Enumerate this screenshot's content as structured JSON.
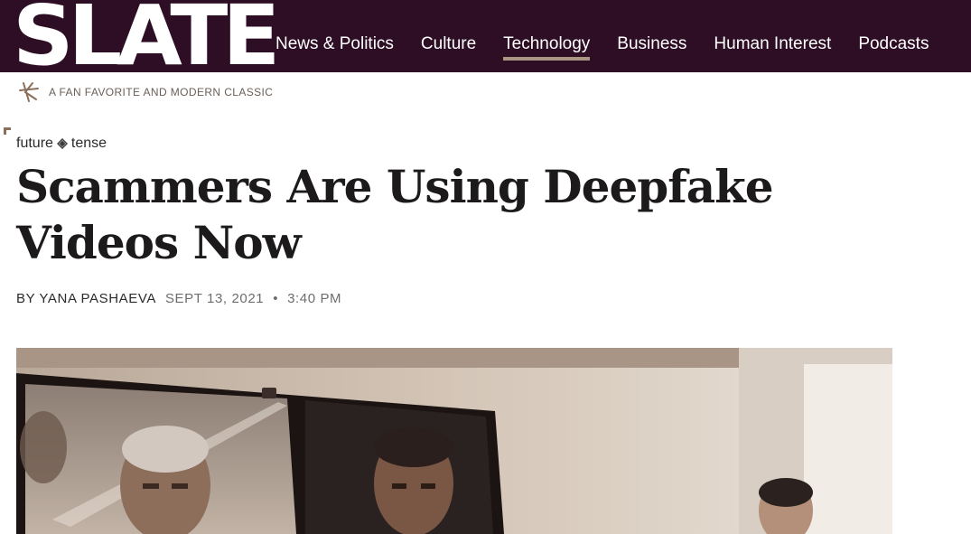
{
  "header": {
    "logo_text": "SLATE",
    "nav": [
      {
        "label": "News & Politics",
        "active": false
      },
      {
        "label": "Culture",
        "active": false
      },
      {
        "label": "Technology",
        "active": true
      },
      {
        "label": "Business",
        "active": false
      },
      {
        "label": "Human Interest",
        "active": false
      },
      {
        "label": "Podcasts",
        "active": false
      }
    ]
  },
  "tagline": {
    "text": "A FAN FAVORITE AND MODERN CLASSIC"
  },
  "kicker": {
    "left": "future",
    "right": "tense",
    "icon": "future-tense-icon"
  },
  "article": {
    "headline": "Scammers Are Using Deepfake Videos Now",
    "author": "BY YANA PASHAEVA",
    "date": "SEPT 13, 2021",
    "separator": "•",
    "time": "3:40 PM"
  },
  "colors": {
    "header_bg": "#2d0e25",
    "active_underline": "#a89582",
    "headline": "#1c1a1b",
    "meta": "#6d6d6d"
  }
}
